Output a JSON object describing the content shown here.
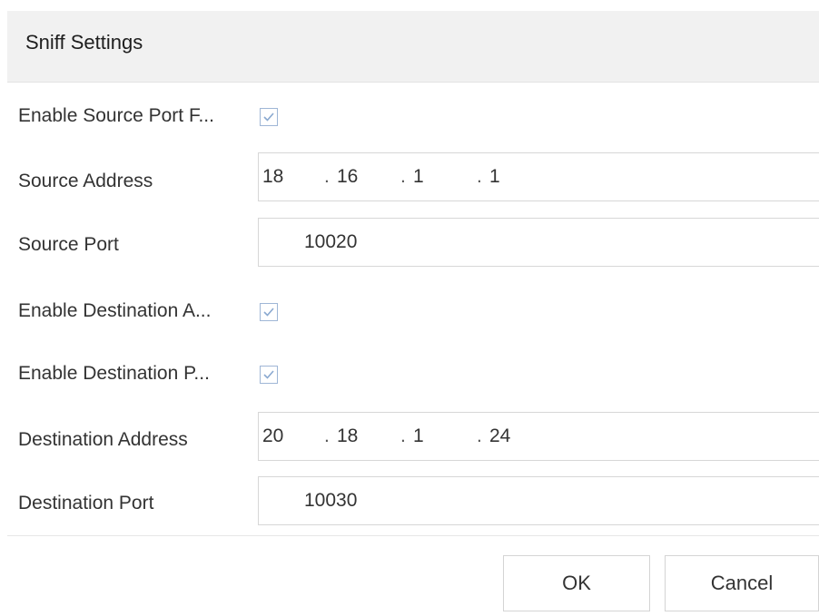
{
  "dialog": {
    "title": "Sniff Settings"
  },
  "form": {
    "enable_source_port_filter": {
      "label": "Enable Source Port F...",
      "checked": true
    },
    "source_address": {
      "label": "Source Address",
      "octets": [
        "18",
        "16",
        "1",
        "1"
      ]
    },
    "source_port": {
      "label": "Source Port",
      "value": "10020"
    },
    "enable_destination_address": {
      "label": "Enable Destination A...",
      "checked": true
    },
    "enable_destination_port": {
      "label": "Enable Destination P...",
      "checked": true
    },
    "destination_address": {
      "label": "Destination Address",
      "octets": [
        "20",
        "18",
        "1",
        "24"
      ]
    },
    "destination_port": {
      "label": "Destination Port",
      "value": "10030"
    }
  },
  "buttons": {
    "ok_label": "OK",
    "cancel_label": "Cancel"
  },
  "ip_separator": ".",
  "colors": {
    "title_bar": "#f1f1f1",
    "checkbox_border": "#9fb6d6",
    "checkmark": "#8aa9d0"
  },
  "icons": {
    "checkbox": "checkmark-icon"
  }
}
